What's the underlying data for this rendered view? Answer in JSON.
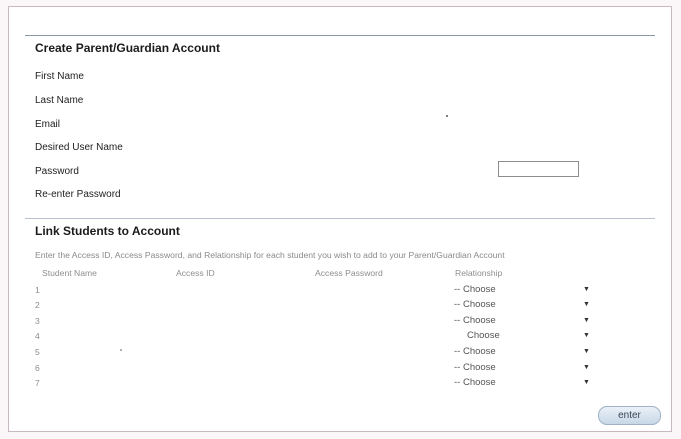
{
  "create_section": {
    "title": "Create Parent/Guardian Account",
    "fields": {
      "first_name": "First Name",
      "last_name": "Last Name",
      "email": "Email",
      "user_name": "Desired User Name",
      "password": "Password",
      "reenter_password": "Re-enter Password"
    }
  },
  "link_section": {
    "title": "Link Students to Account",
    "instructions": "Enter the Access ID, Access Password, and Relationship for each student you wish to add to your Parent/Guardian Account",
    "columns": {
      "student_name": "Student Name",
      "access_id": "Access ID",
      "access_password": "Access Password",
      "relationship": "Relationship"
    },
    "rows": [
      {
        "number": "1",
        "relationship": "-- Choose"
      },
      {
        "number": "2",
        "relationship": "-- Choose"
      },
      {
        "number": "3",
        "relationship": "-- Choose"
      },
      {
        "number": "4",
        "relationship": "Choose"
      },
      {
        "number": "5",
        "relationship": "-- Choose"
      },
      {
        "number": "6",
        "relationship": "-- Choose"
      },
      {
        "number": "7",
        "relationship": "-- Choose"
      }
    ]
  },
  "enter_button": "enter",
  "icons": {
    "dropdown": "dropdown-arrow-icon"
  }
}
